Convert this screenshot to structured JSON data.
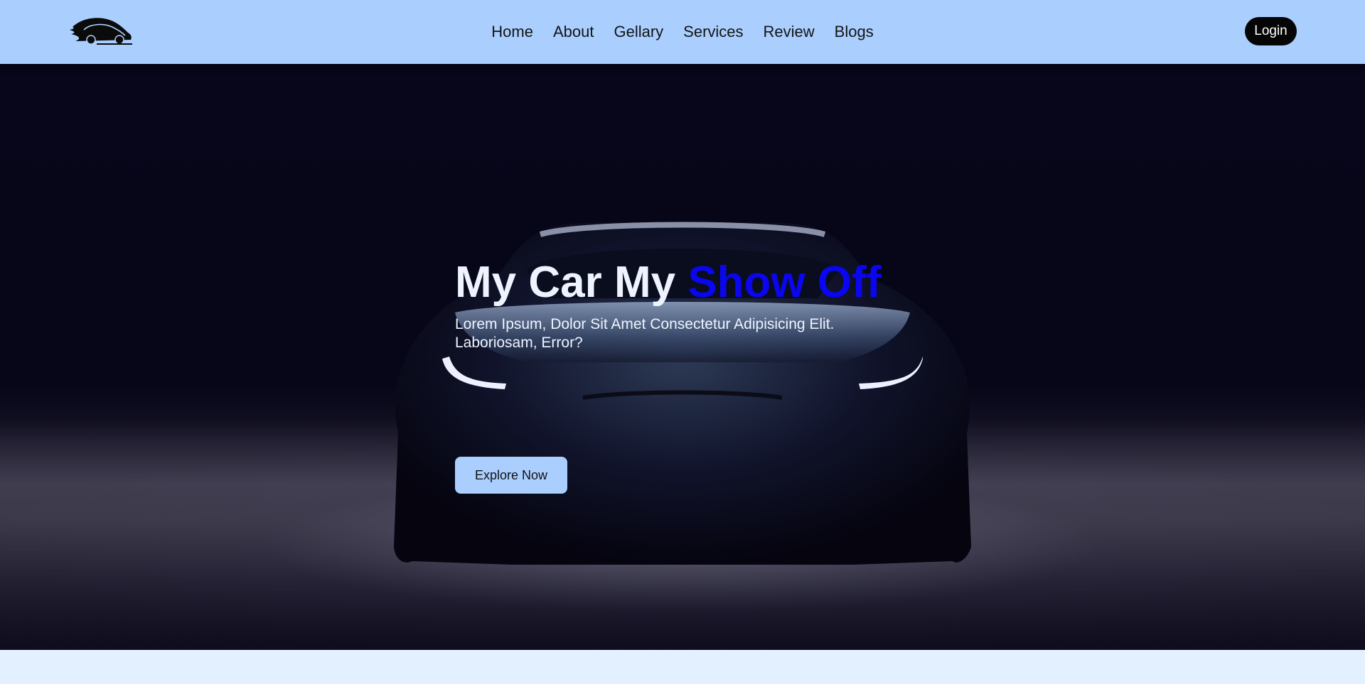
{
  "header": {
    "logo_icon": "car-logo-icon",
    "nav": [
      "Home",
      "About",
      "Gellary",
      "Services",
      "Review",
      "Blogs"
    ],
    "login_label": "Login",
    "background": "#aacfff"
  },
  "hero": {
    "title_main": "My Car My ",
    "title_accent": "Show Off",
    "subtitle": "Lorem Ipsum, Dolor Sit Amet Consectetur Adipisicing Elit. Laboriosam, Error?",
    "cta_label": "Explore Now",
    "accent_color": "#0a06f0",
    "background_image": "car-front-dark-image"
  }
}
